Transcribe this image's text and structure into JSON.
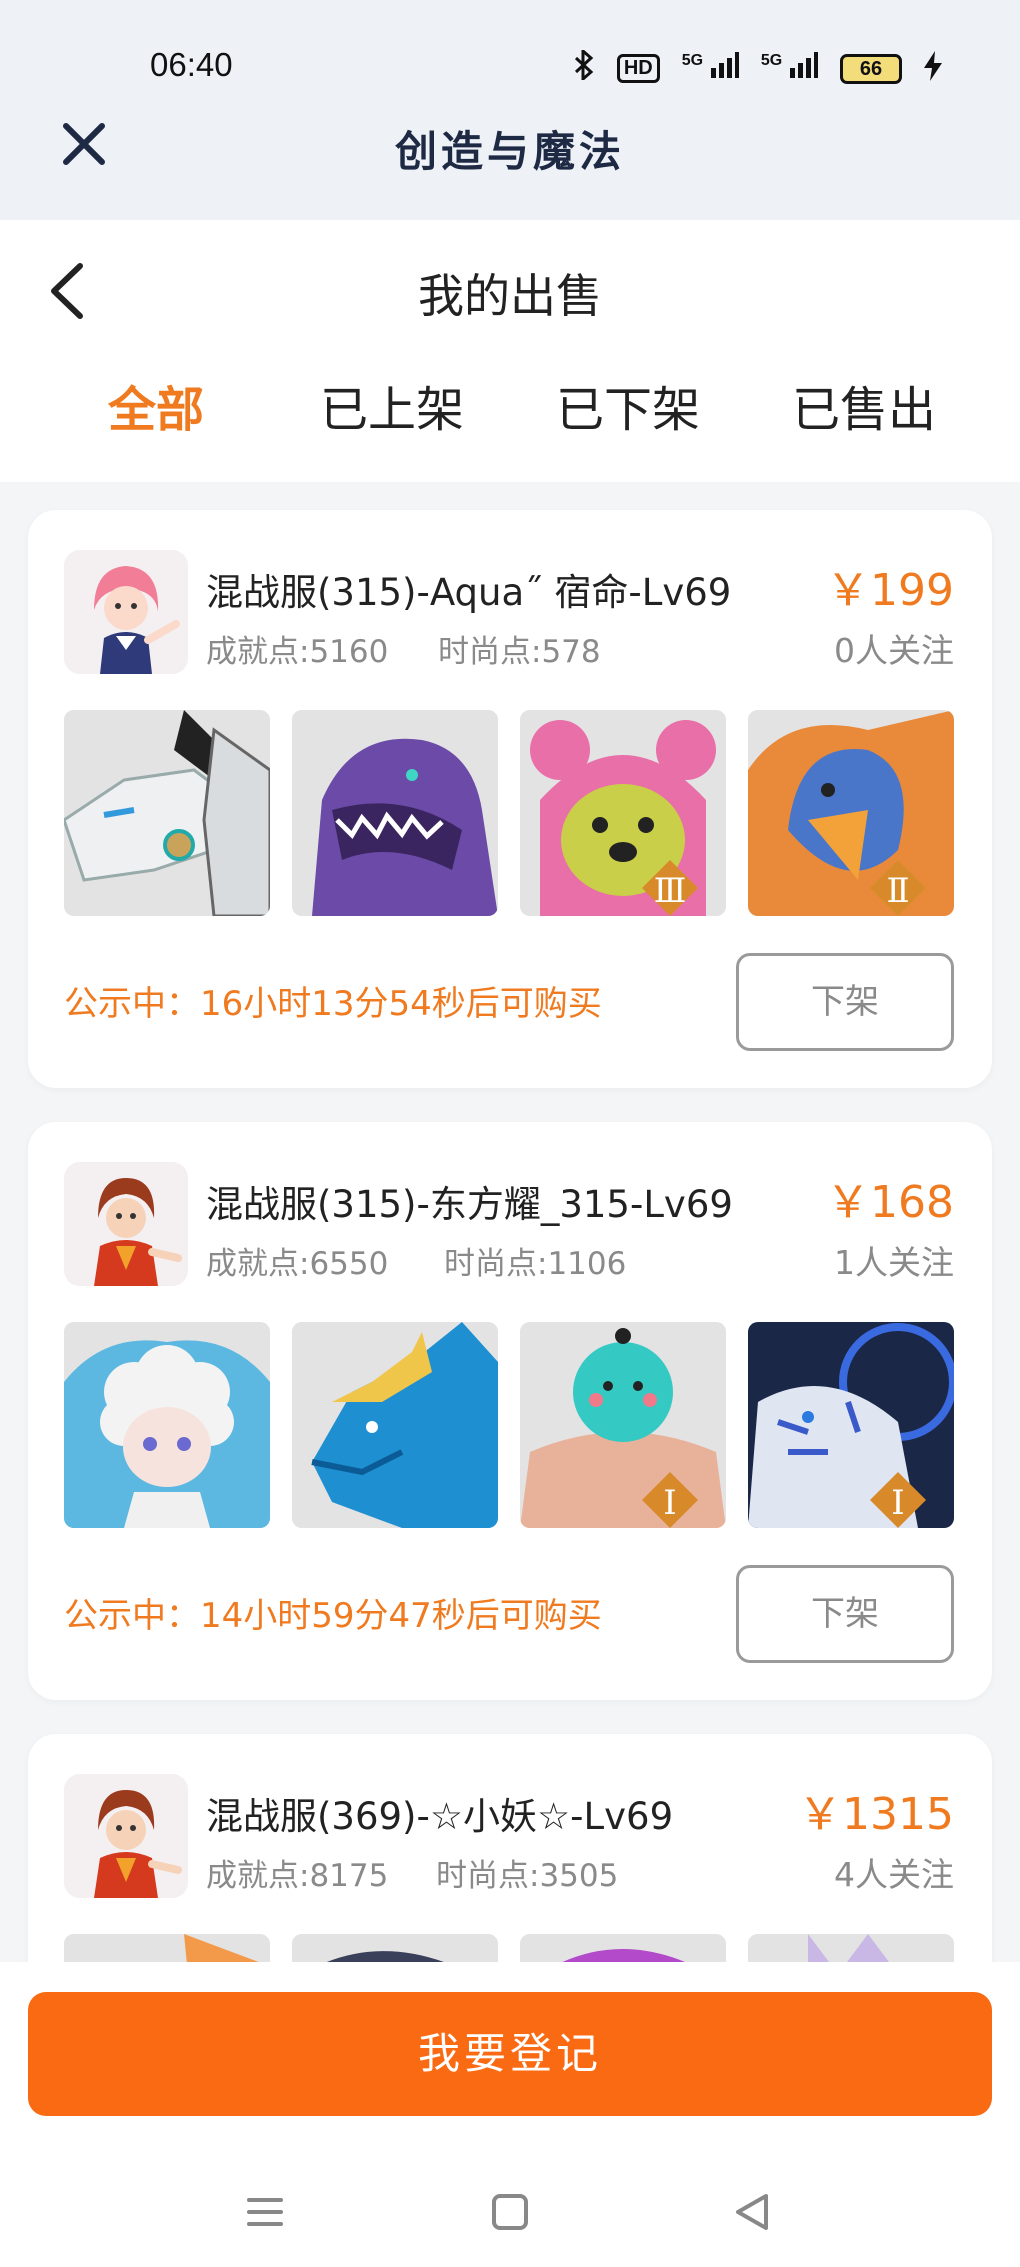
{
  "status_bar": {
    "time": "06:40",
    "icons": [
      "bluetooth-icon",
      "hd-icon",
      "signal-5g-icon",
      "signal-5g-icon"
    ],
    "hd_label": "HD",
    "net1": "5G",
    "net2": "5G",
    "battery": "66"
  },
  "app": {
    "title": "创造与魔法",
    "close_icon": "close-icon"
  },
  "page": {
    "title": "我的出售",
    "back_icon": "chevron-left-icon"
  },
  "tabs": [
    {
      "label": "全部",
      "active": true
    },
    {
      "label": "已上架",
      "active": false
    },
    {
      "label": "已下架",
      "active": false
    },
    {
      "label": "已售出",
      "active": false
    }
  ],
  "listings": [
    {
      "name": "混战服(315)-Aqua˝ 宿命-Lv69",
      "achievement": "成就点:5160",
      "fashion": "时尚点:578",
      "price": "￥199",
      "followers": "0人关注",
      "status": "公示中：16小时13分54秒后可购买",
      "action": "下架",
      "thumbs": [
        "white-mecha-dragon",
        "purple-dinosaur",
        "pink-bear-tier-3",
        "eagle-griffin-tier-2"
      ]
    },
    {
      "name": "混战服(315)-东方耀_315-Lv69",
      "achievement": "成就点:6550",
      "fashion": "时尚点:1106",
      "price": "￥168",
      "followers": "1人关注",
      "status": "公示中：14小时59分47秒后可购买",
      "action": "下架",
      "thumbs": [
        "cloud-sheep-doll",
        "blue-ice-dragon",
        "teal-bird-tier-1",
        "white-tiger-tier-1"
      ]
    },
    {
      "name": "混战服(369)-☆小妖☆-Lv69",
      "achievement": "成就点:8175",
      "fashion": "时尚点:3505",
      "price": "￥1315",
      "followers": "4人关注",
      "status": "",
      "action": "",
      "thumbs": [
        "orange-mount",
        "dark-mount",
        "purple-mount",
        "light-mount"
      ]
    }
  ],
  "bottom": {
    "register_label": "我要登记"
  },
  "colors": {
    "accent": "#f07a1f",
    "button": "#fa6a12",
    "header_bg": "#eef2f7"
  }
}
